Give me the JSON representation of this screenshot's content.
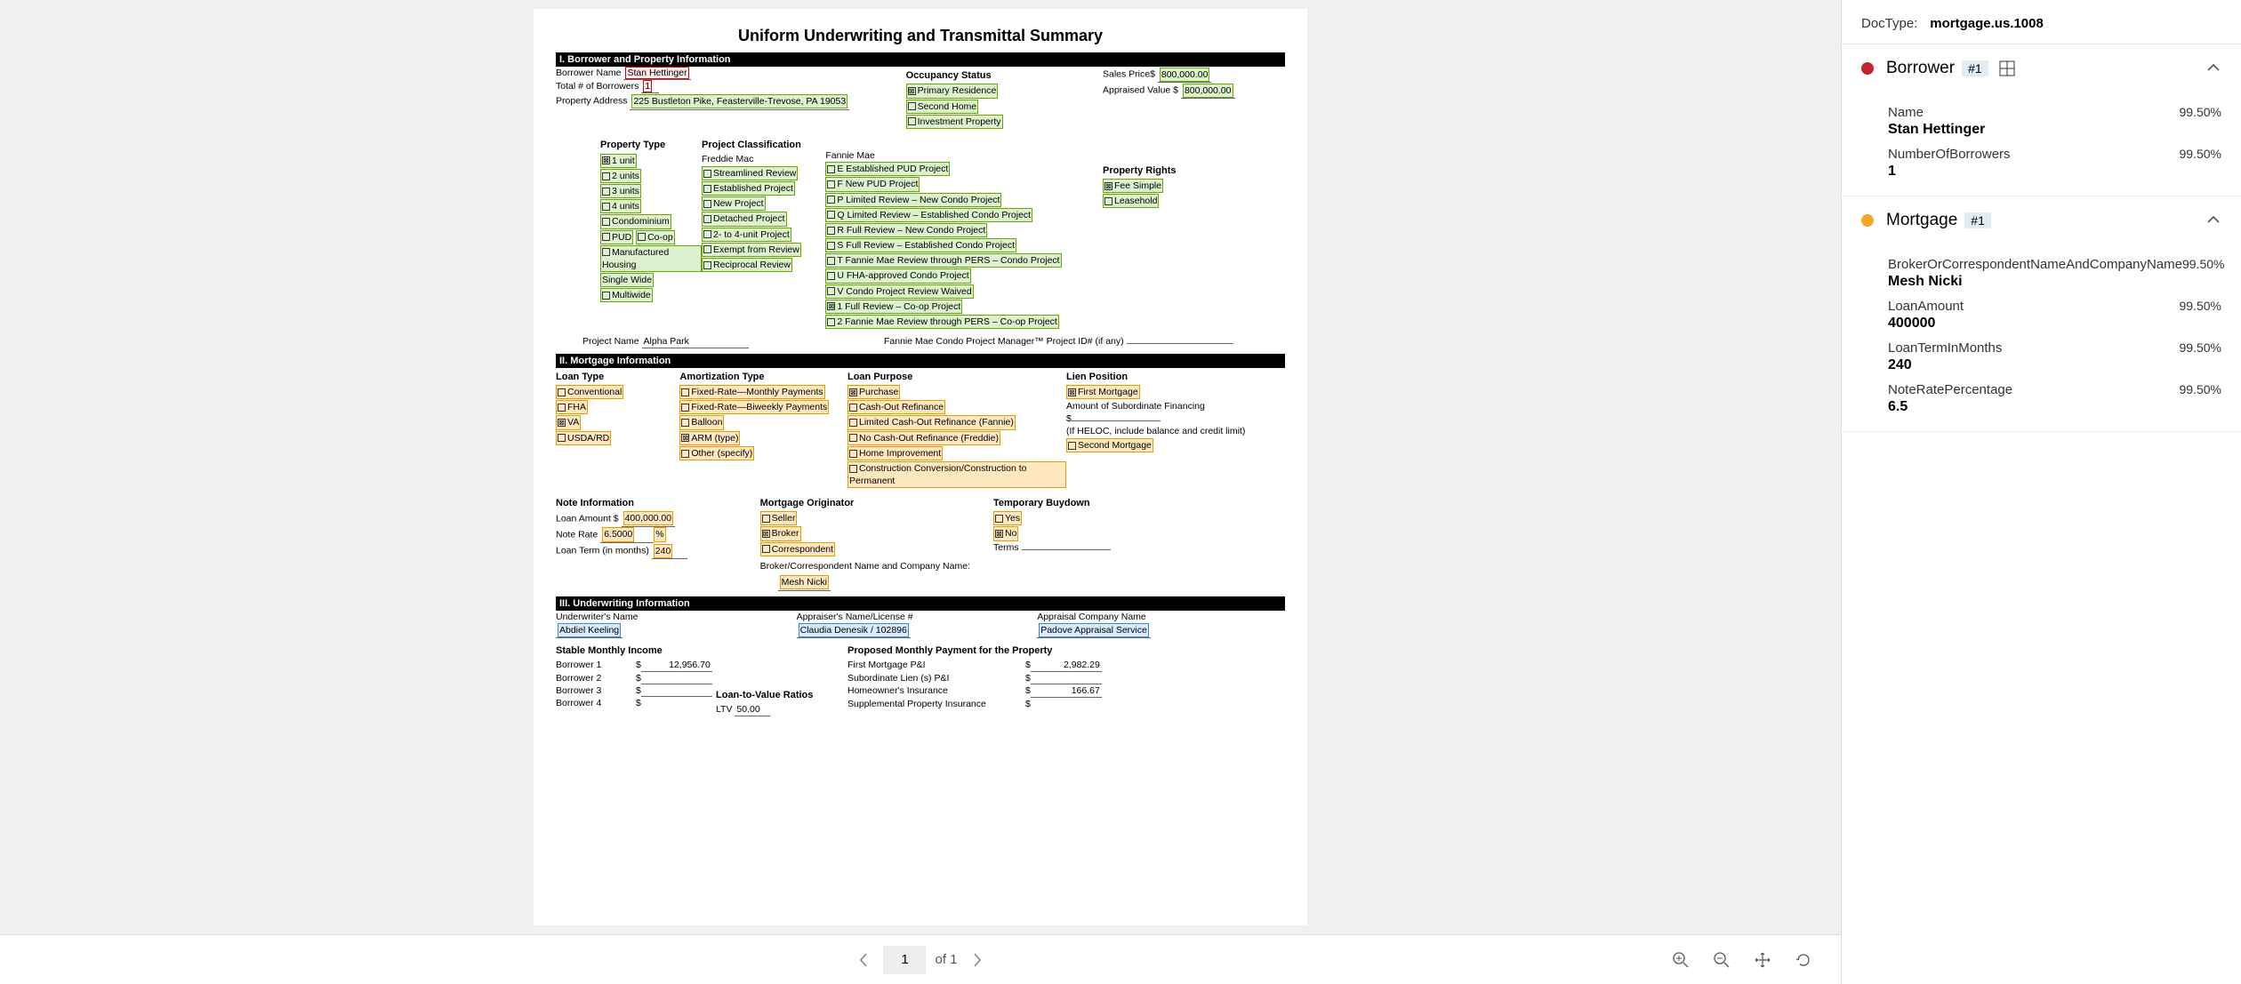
{
  "docTypeLabel": "DocType:",
  "docType": "mortgage.us.1008",
  "title": "Uniform Underwriting and Transmittal Summary",
  "section1": {
    "header": "I. Borrower and Property Information",
    "borrowerNameLabel": "Borrower Name",
    "borrowerName": "Stan Hettinger",
    "totalBorrowersLabel": "Total # of Borrowers",
    "totalBorrowers": "1",
    "addressLabel": "Property Address",
    "address": "225 Bustleton Pike, Feasterville-Trevose, PA 19053",
    "occupancyLabel": "Occupancy Status",
    "occupancy": [
      "Primary Residence",
      "Second Home",
      "Investment Property"
    ],
    "salesPriceLabel": "Sales Price$",
    "salesPrice": "800,000.00",
    "appraisedLabel": "Appraised Value $",
    "appraised": "800,000.00",
    "propTypeLabel": "Property Type",
    "propTypes": [
      "1 unit",
      "2 units",
      "3 units",
      "4 units",
      "Condominium",
      "PUD",
      "Co-op",
      "Manufactured Housing",
      "Single Wide",
      "Multiwide"
    ],
    "projClassLabel": "Project Classification",
    "freddieLabel": "Freddie Mac",
    "freddie": [
      "Streamlined Review",
      "Established Project",
      "New Project",
      "Detached Project",
      "2- to 4-unit Project",
      "Exempt from Review",
      "Reciprocal Review"
    ],
    "fannieLabel": "Fannie Mae",
    "fannie": [
      "E Established PUD Project",
      "F New PUD Project",
      "P Limited Review – New Condo Project",
      "Q Limited Review – Established Condo Project",
      "R Full Review – New Condo Project",
      "S Full Review – Established Condo Project",
      "T Fannie Mae Review through PERS – Condo Project",
      "U FHA-approved Condo Project",
      "V Condo Project Review Waived",
      "1 Full Review – Co-op Project",
      "2 Fannie Mae Review through PERS – Co-op Project"
    ],
    "propRightsLabel": "Property Rights",
    "propRights": [
      "Fee Simple",
      "Leasehold"
    ],
    "projectNameLabel": "Project Name",
    "projectName": "Alpha Park",
    "fannieIdLabel": "Fannie Mae Condo Project Manager™ Project ID# (if any)"
  },
  "section2": {
    "header": "II. Mortgage Information",
    "loanTypeLabel": "Loan Type",
    "loanTypes": [
      "Conventional",
      "FHA",
      "VA",
      "USDA/RD"
    ],
    "amortLabel": "Amortization Type",
    "amort": [
      "Fixed-Rate—Monthly Payments",
      "Fixed-Rate—Biweekly Payments",
      "Balloon",
      "ARM (type)",
      "Other (specify)"
    ],
    "purposeLabel": "Loan Purpose",
    "purposes": [
      "Purchase",
      "Cash-Out Refinance",
      "Limited Cash-Out Refinance (Fannie)",
      "No Cash-Out Refinance (Freddie)",
      "Home Improvement",
      "Construction Conversion/Construction to Permanent"
    ],
    "lienLabel": "Lien Position",
    "lien1": "First Mortgage",
    "subFinLabel": "Amount of Subordinate Financing",
    "dollar": "$",
    "helocNote": "(If HELOC, include balance and credit limit)",
    "lien2": "Second Mortgage",
    "noteInfoLabel": "Note Information",
    "loanAmountLabel": "Loan Amount $",
    "loanAmount": "400,000.00",
    "noteRateLabel": "Note Rate",
    "noteRate": "6.5000",
    "pct": "%",
    "loanTermLabel": "Loan Term (in months)",
    "loanTerm": "240",
    "originatorLabel": "Mortgage Originator",
    "originators": [
      "Seller",
      "Broker",
      "Correspondent"
    ],
    "brokerNameLabel": "Broker/Correspondent Name and Company Name:",
    "brokerName": "Mesh Nicki",
    "buydownLabel": "Temporary Buydown",
    "buydownYes": "Yes",
    "buydownNo": "No",
    "termsLabel": "Terms"
  },
  "section3": {
    "header": "III. Underwriting Information",
    "uwNameLabel": "Underwriter's Name",
    "uwName": "Abdiel Keeling",
    "appraiserLabel": "Appraiser's Name/License #",
    "appraiser": "Claudia Denesik / 102896",
    "appraisalCoLabel": "Appraisal Company Name",
    "appraisalCo": "Padove Appraisal Service",
    "stableIncomeLabel": "Stable Monthly Income",
    "b1": "Borrower 1",
    "b2": "Borrower 2",
    "b3": "Borrower 3",
    "b4": "Borrower 4",
    "b1val": "12,956.70",
    "proposedLabel": "Proposed Monthly Payment for the Property",
    "p1": "First Mortgage P&I",
    "p1val": "2,982.29",
    "p2": "Subordinate Lien (s) P&I",
    "p3": "Homeowner's Insurance",
    "p3val": "166.67",
    "p4": "Supplemental Property Insurance",
    "ltvLabel": "Loan-to-Value Ratios",
    "ltvRow": "LTV",
    "ltvVal": "50.00"
  },
  "toolbar": {
    "page": "1",
    "of": "of 1"
  },
  "panel": {
    "borrower": {
      "label": "Borrower",
      "badge": "#1",
      "fields": [
        {
          "name": "Name",
          "conf": "99.50%",
          "val": "Stan Hettinger"
        },
        {
          "name": "NumberOfBorrowers",
          "conf": "99.50%",
          "val": "1"
        }
      ]
    },
    "mortgage": {
      "label": "Mortgage",
      "badge": "#1",
      "fields": [
        {
          "name": "BrokerOrCorrespondentNameAndCompanyName",
          "conf": "99.50%",
          "val": "Mesh Nicki"
        },
        {
          "name": "LoanAmount",
          "conf": "99.50%",
          "val": "400000"
        },
        {
          "name": "LoanTermInMonths",
          "conf": "99.50%",
          "val": "240"
        },
        {
          "name": "NoteRatePercentage",
          "conf": "99.50%",
          "val": "6.5"
        }
      ]
    }
  }
}
